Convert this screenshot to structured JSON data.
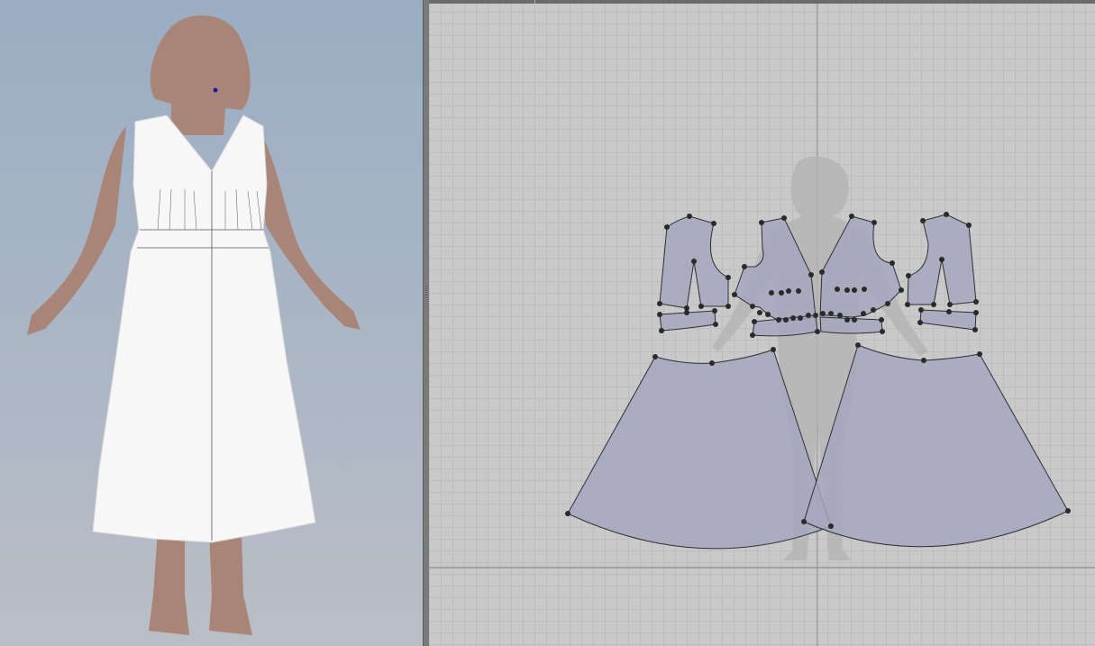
{
  "colors": {
    "viewport_3d_top": "#9badc3",
    "viewport_3d_bottom": "#b9bec6",
    "viewport_2d_bg": "#c9c9c9",
    "pattern_fill": "#a6a6bf",
    "pattern_stroke": "#2e2e36",
    "avatar_skin": "#a88478",
    "garment": "#f7f7f7"
  },
  "icons": {
    "splitter": "splitter-grip-icon"
  }
}
